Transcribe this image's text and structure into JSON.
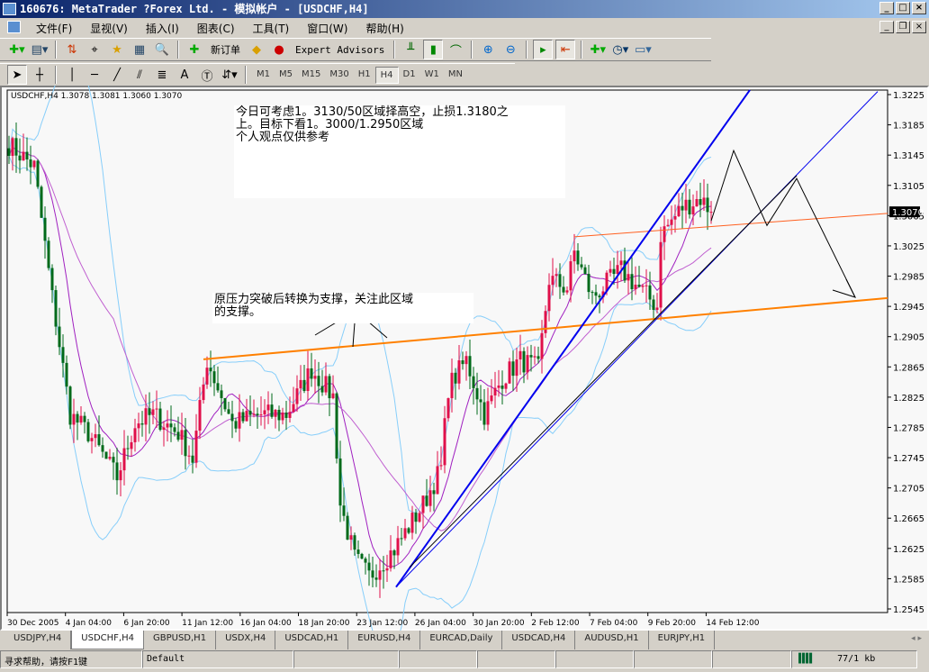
{
  "window": {
    "title": "160676: MetaTrader ?Forex Ltd. - 模拟帐户 - [USDCHF,H4]"
  },
  "menu": [
    "文件(F)",
    "显视(V)",
    "插入(I)",
    "图表(C)",
    "工具(T)",
    "窗口(W)",
    "帮助(H)"
  ],
  "toolbar": {
    "new_order": "新订单",
    "expert_advisors": "Expert Advisors",
    "timeframes": [
      "M1",
      "M5",
      "M15",
      "M30",
      "H1",
      "H4",
      "D1",
      "W1",
      "MN"
    ],
    "active_timeframe": "H4"
  },
  "chart": {
    "header": "USDCHF,H4  1.3078 1.3081 1.3060 1.3070",
    "current_price": "1.3070",
    "note1": [
      "今日可考虑1。3130/50区域择高空，止损1.3180之",
      "上。目标下看1。3000/1.2950区域",
      "个人观点仅供参考"
    ],
    "note2": [
      "原压力突破后转换为支撑，关注此区域",
      "的支撑。"
    ]
  },
  "chart_data": {
    "type": "candlestick",
    "symbol": "USDCHF",
    "timeframe": "H4",
    "ylim": [
      1.2545,
      1.3225
    ],
    "y_ticks": [
      "1.3225",
      "1.3185",
      "1.3145",
      "1.3105",
      "1.3065",
      "1.3025",
      "1.2985",
      "1.2945",
      "1.2905",
      "1.2865",
      "1.2825",
      "1.2785",
      "1.2745",
      "1.2705",
      "1.2665",
      "1.2625",
      "1.2585",
      "1.2545"
    ],
    "x_ticks": [
      "30 Dec 2005",
      "4 Jan 04:00",
      "6 Jan 20:00",
      "11 Jan 12:00",
      "16 Jan 04:00",
      "18 Jan 20:00",
      "23 Jan 12:00",
      "26 Jan 04:00",
      "30 Jan 20:00",
      "2 Feb 12:00",
      "7 Feb 04:00",
      "9 Feb 20:00",
      "14 Feb 12:00"
    ],
    "close_path": [
      [
        0,
        1.3159
      ],
      [
        7,
        1.313
      ],
      [
        12,
        1.2957
      ],
      [
        17,
        1.2802
      ],
      [
        22,
        1.2778
      ],
      [
        30,
        1.2719
      ],
      [
        35,
        1.279
      ],
      [
        40,
        1.2802
      ],
      [
        47,
        1.2778
      ],
      [
        51,
        1.2743
      ],
      [
        55,
        1.2874
      ],
      [
        62,
        1.279
      ],
      [
        70,
        1.2802
      ],
      [
        77,
        1.2802
      ],
      [
        84,
        1.2862
      ],
      [
        90,
        1.2826
      ],
      [
        92,
        1.2683
      ],
      [
        96,
        1.2612
      ],
      [
        100,
        1.2588
      ],
      [
        107,
        1.2624
      ],
      [
        115,
        1.2683
      ],
      [
        120,
        1.2731
      ],
      [
        122,
        1.2838
      ],
      [
        127,
        1.2874
      ],
      [
        132,
        1.2802
      ],
      [
        137,
        1.285
      ],
      [
        142,
        1.2874
      ],
      [
        147,
        1.2862
      ],
      [
        150,
        1.2981
      ],
      [
        155,
        1.2969
      ],
      [
        157,
        1.3017
      ],
      [
        162,
        1.2957
      ],
      [
        170,
        1.2993
      ],
      [
        175,
        1.2969
      ],
      [
        180,
        1.2945
      ],
      [
        181,
        1.304
      ],
      [
        187,
        1.3076
      ],
      [
        192,
        1.3088
      ],
      [
        195,
        1.307
      ]
    ],
    "trendlines": [
      {
        "color": "#ff8000",
        "width": 2,
        "p": [
          [
            54,
            1.2875
          ],
          [
            244,
            1.2956
          ]
        ]
      },
      {
        "color": "#ff6020",
        "width": 1,
        "p": [
          [
            157,
            1.3037
          ],
          [
            244,
            1.3068
          ]
        ]
      },
      {
        "color": "#0000ee",
        "width": 2,
        "p": [
          [
            107.5,
            1.2574
          ],
          [
            205.75,
            1.3231
          ]
        ]
      },
      {
        "color": "#0000ee",
        "width": 1,
        "p": [
          [
            107.5,
            1.2574
          ],
          [
            241.25,
            1.3229
          ]
        ]
      },
      {
        "color": "#000000",
        "width": 1,
        "p": [
          [
            111.25,
            1.26
          ],
          [
            218.75,
            1.3118
          ]
        ]
      },
      {
        "color": "#000000",
        "width": 1,
        "p": [
          [
            195,
            1.3058
          ],
          [
            201.25,
            1.3151
          ],
          [
            210.5,
            1.3052
          ],
          [
            218.75,
            1.3114
          ],
          [
            235,
            1.2957
          ]
        ]
      }
    ],
    "colors": {
      "up": "#e0104a",
      "down": "#006a1a",
      "bands": "#87cefa",
      "ma": "#a020c0"
    }
  },
  "tabs": [
    "USDJPY,H4",
    "USDCHF,H4",
    "GBPUSD,H1",
    "USDX,H4",
    "USDCAD,H1",
    "EURUSD,H4",
    "EURCAD,Daily",
    "USDCAD,H4",
    "AUDUSD,H1",
    "EURJPY,H1"
  ],
  "active_tab": "USDCHF,H4",
  "status": {
    "help": "寻求帮助，请按F1键",
    "profile": "Default",
    "traffic": "77/1 kb"
  }
}
